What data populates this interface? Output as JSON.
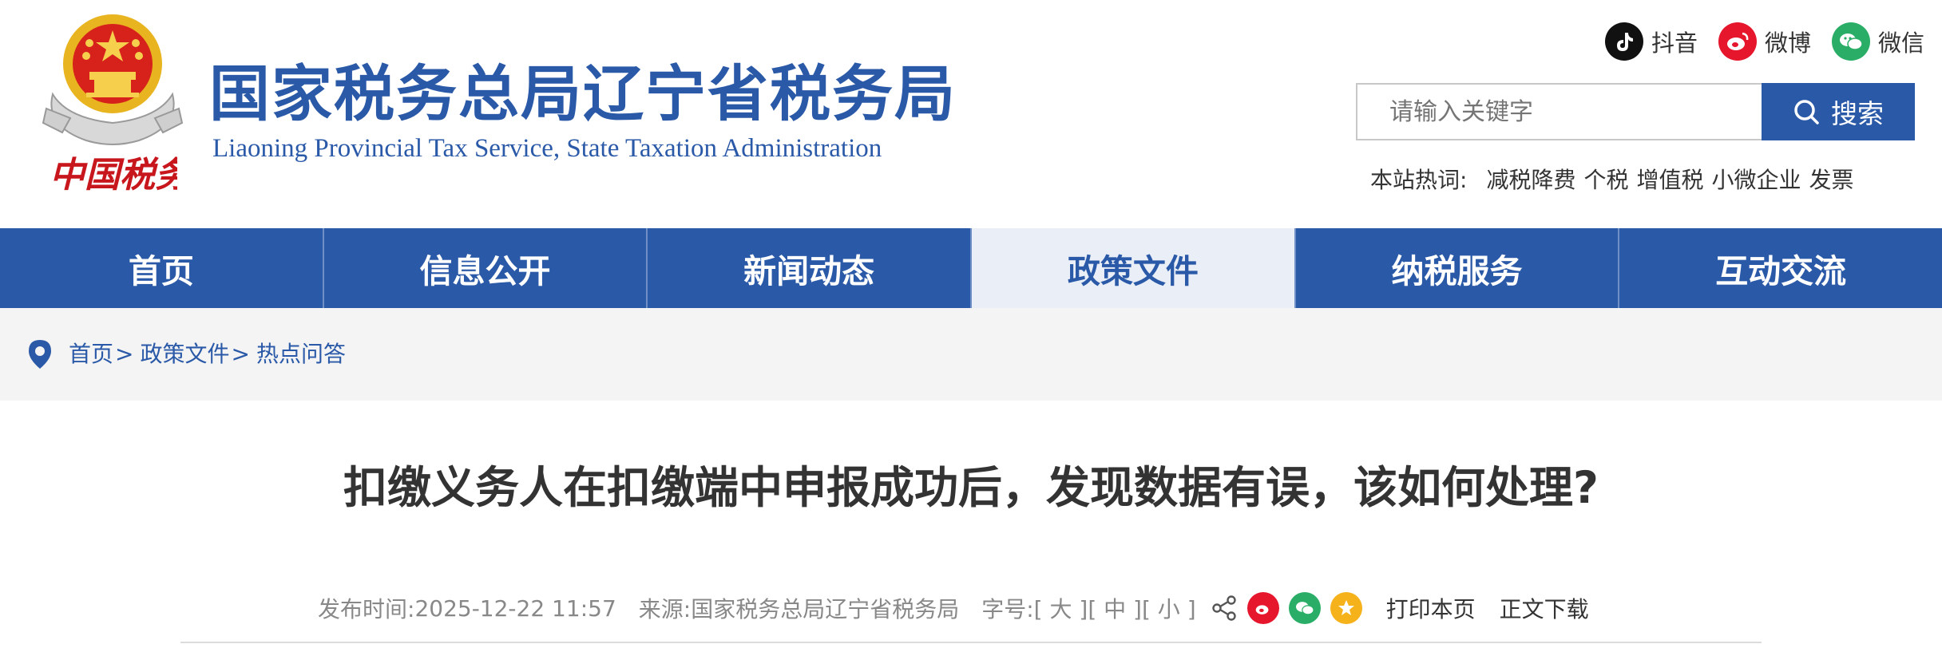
{
  "header": {
    "title": "国家税务总局辽宁省税务局",
    "subtitle": "Liaoning Provincial Tax Service, State Taxation Administration",
    "brand_seal": "中国税务",
    "social": [
      {
        "label": "抖音",
        "icon": "douyin-icon"
      },
      {
        "label": "微博",
        "icon": "weibo-icon"
      },
      {
        "label": "微信",
        "icon": "wechat-icon"
      }
    ],
    "search": {
      "placeholder": "请输入关键字",
      "button_label": "搜索"
    },
    "hotwords": {
      "label": "本站热词:",
      "items": [
        "减税降费",
        "个税",
        "增值税",
        "小微企业",
        "发票"
      ]
    }
  },
  "nav": {
    "items": [
      "首页",
      "信息公开",
      "新闻动态",
      "政策文件",
      "纳税服务",
      "互动交流"
    ],
    "active": "政策文件"
  },
  "breadcrumb": [
    "首页",
    "政策文件",
    "热点问答"
  ],
  "article": {
    "title": "扣缴义务人在扣缴端中申报成功后，发现数据有误，该如何处理?",
    "meta": {
      "publish_label": "发布时间:",
      "publish_time": "2025-12-22 11:57",
      "source_label": "来源:",
      "source": "国家税务总局辽宁省税务局",
      "fontsize_label": "字号:",
      "fontsize_options": [
        "[ 大 ]",
        "[ 中 ]",
        "[ 小 ]"
      ],
      "print_label": "打印本页",
      "download_label": "正文下载"
    }
  },
  "colors": {
    "brand": "#2a59a8",
    "nav_active_bg": "#e9eef7",
    "weibo": "#e6162d",
    "wechat": "#2aae67",
    "qzone": "#f5b21a"
  }
}
